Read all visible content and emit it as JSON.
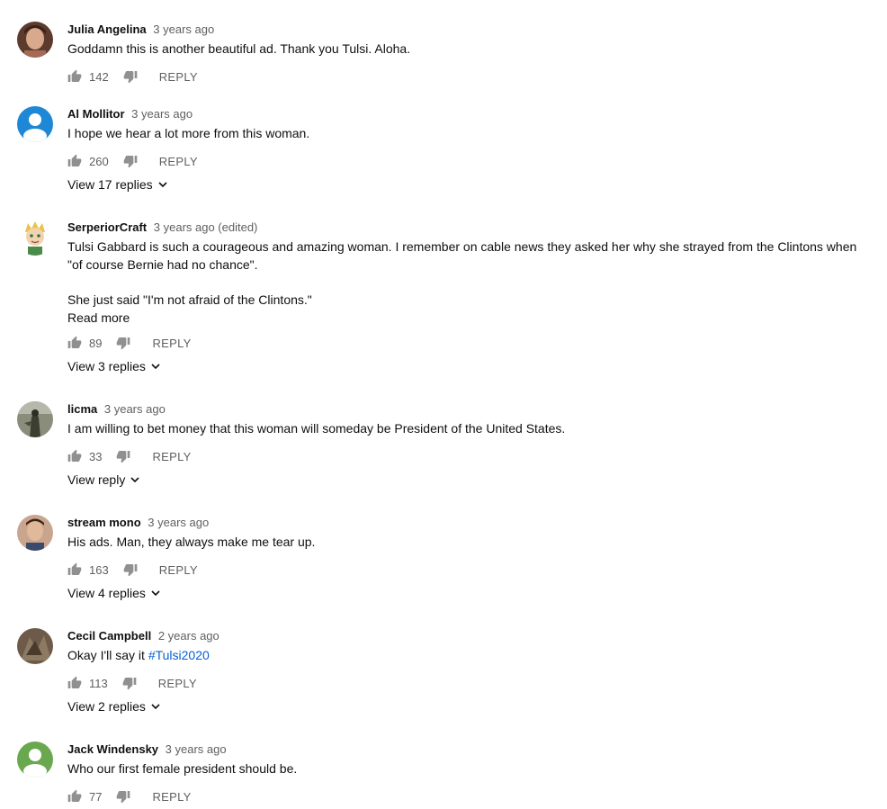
{
  "comments": [
    {
      "author": "Julia Angelina",
      "time": "3 years ago",
      "lines": [
        "Goddamn this is another beautiful ad. Thank you Tulsi. Aloha."
      ],
      "likes": "142",
      "reply_label": "REPLY",
      "avatar": {
        "icon": "photo-avatar",
        "color": "#7a4b3a"
      }
    },
    {
      "author": "Al Mollitor",
      "time": "3 years ago",
      "lines": [
        "I hope we hear a lot more from this woman."
      ],
      "likes": "260",
      "reply_label": "REPLY",
      "view_replies": "View 17 replies",
      "avatar": {
        "icon": "default-user-avatar",
        "color": "#1e88d6"
      }
    },
    {
      "author": "SerperiorCraft",
      "time": "3 years ago (edited)",
      "lines": [
        "Tulsi Gabbard is such a courageous and amazing woman. I remember on cable news they asked her why she strayed from the Clintons when \"of course Bernie had no chance\".",
        "She just said \"I'm not afraid of the Clintons.\""
      ],
      "read_more": "Read more",
      "likes": "89",
      "reply_label": "REPLY",
      "view_replies": "View 3 replies",
      "avatar": {
        "icon": "cartoon-avatar",
        "color": "#e8d07a"
      }
    },
    {
      "author": "licma",
      "time": "3 years ago",
      "lines": [
        "I am willing to bet money that this woman will someday be President of the United States."
      ],
      "likes": "33",
      "reply_label": "REPLY",
      "view_replies": "View reply",
      "avatar": {
        "icon": "photo-avatar",
        "color": "#6b6f5e"
      }
    },
    {
      "author": "stream mono",
      "time": "3 years ago",
      "lines": [
        "His ads. Man, they always make me tear up."
      ],
      "likes": "163",
      "reply_label": "REPLY",
      "view_replies": "View 4 replies",
      "avatar": {
        "icon": "photo-avatar",
        "color": "#8a5a4a"
      }
    },
    {
      "author": "Cecil Campbell",
      "time": "2 years ago",
      "lines_prefix": "Okay I'll say it ",
      "hashtag": "#Tulsi2020",
      "likes": "113",
      "reply_label": "REPLY",
      "view_replies": "View 2 replies",
      "avatar": {
        "icon": "photo-avatar",
        "color": "#5a4a3a"
      }
    },
    {
      "author": "Jack Windensky",
      "time": "3 years ago",
      "lines": [
        "Who our first female president should be."
      ],
      "likes": "77",
      "reply_label": "REPLY",
      "avatar": {
        "icon": "default-user-avatar",
        "color": "#6aa84f"
      }
    }
  ]
}
